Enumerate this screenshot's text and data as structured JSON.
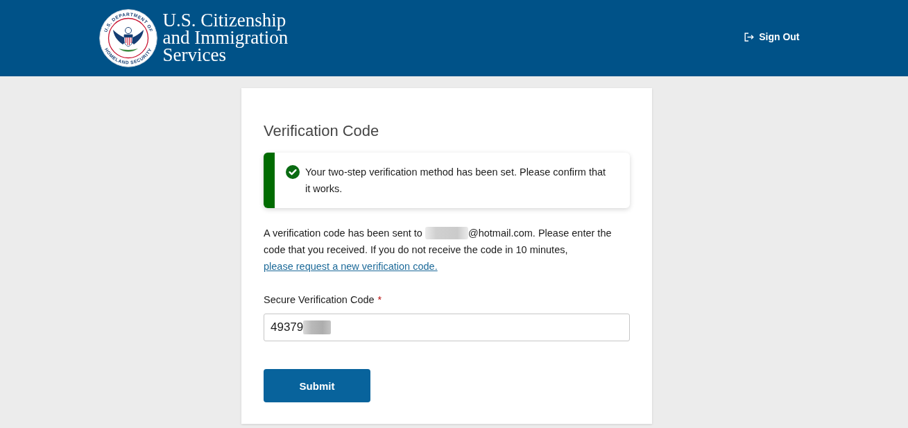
{
  "header": {
    "logo": {
      "seal_text": [
        "U.S. DEPARTMENT OF",
        "HOMELAND SECURITY"
      ],
      "name_lines": [
        "U.S. Citizenship",
        "and Immigration",
        "Services"
      ]
    },
    "sign_out": {
      "label": "Sign Out"
    }
  },
  "card": {
    "title": "Verification Code",
    "alert": {
      "kind": "success",
      "text": "Your two-step verification method has been set. Please confirm that it works."
    },
    "message": [
      {
        "kind": "text",
        "text": "A verification code has been sent to "
      },
      {
        "kind": "redacted"
      },
      {
        "kind": "text",
        "text": "@hotmail.com. Please enter the code that you received. If you do not receive the code in 10 minutes,"
      },
      {
        "kind": "link",
        "text": "please request a new verification code."
      }
    ],
    "field": {
      "label": "Secure Verification Code",
      "required_mark": "*",
      "value": "49379",
      "blurred": true
    },
    "submit": {
      "label": "Submit"
    }
  }
}
